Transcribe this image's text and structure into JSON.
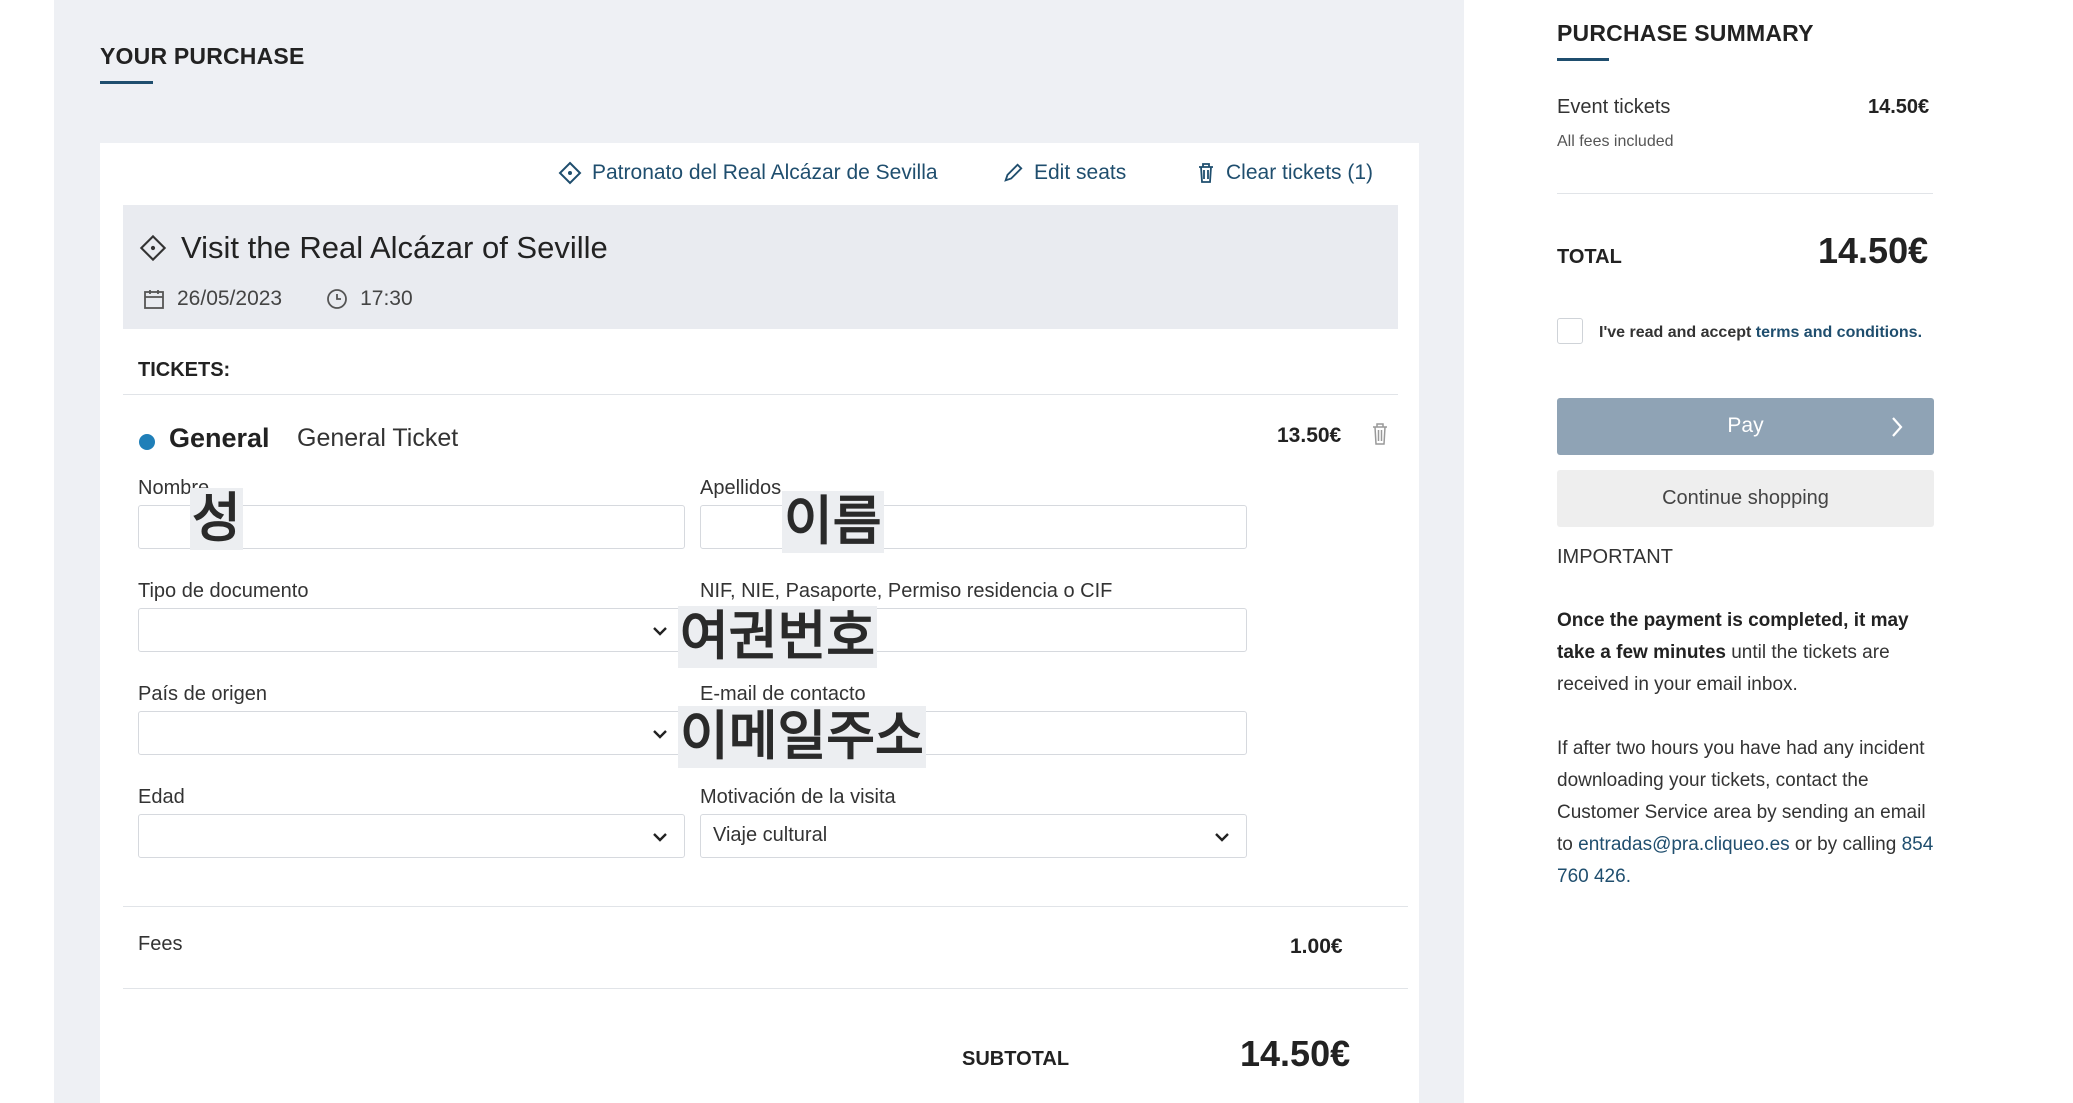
{
  "purchase": {
    "title": "YOUR PURCHASE",
    "links": {
      "venue": "Patronato del Real Alcázar de Sevilla",
      "edit_seats": "Edit seats",
      "clear_tickets": "Clear tickets (1)"
    },
    "event": {
      "title": "Visit the Real Alcázar of Seville",
      "date": "26/05/2023",
      "time": "17:30"
    },
    "tickets_heading": "TICKETS:",
    "ticket": {
      "category": "General",
      "name": "General Ticket",
      "price": "13.50€",
      "dot_color": "#1f7fb8"
    },
    "form": {
      "nombre_label": "Nombre",
      "apellidos_label": "Apellidos",
      "tipo_documento_label": "Tipo de documento",
      "documento_numero_label": "NIF, NIE, Pasaporte, Permiso residencia o CIF",
      "pais_label": "País de origen",
      "email_label": "E-mail de contacto",
      "edad_label": "Edad",
      "motivacion_label": "Motivación de la visita",
      "motivacion_value": "Viaje cultural"
    },
    "annotations": {
      "surname": "성",
      "given_name": "이름",
      "passport_number": "여권번호",
      "email": "이메일주소"
    },
    "fees_label": "Fees",
    "fees_value": "1.00€",
    "subtotal_label": "SUBTOTAL",
    "subtotal_value": "14.50€"
  },
  "summary": {
    "title": "PURCHASE SUMMARY",
    "event_tickets_label": "Event tickets",
    "event_tickets_value": "14.50€",
    "fees_note": "All fees included",
    "total_label": "TOTAL",
    "total_value": "14.50€",
    "terms_prefix": "I've read and accept ",
    "terms_link": "terms and conditions.",
    "pay_button": "Pay",
    "continue_button": "Continue shopping",
    "important_heading": "IMPORTANT",
    "important_bold": "Once the payment is completed, it may take a few minutes",
    "important_rest": " until the tickets are received in your email inbox.",
    "incident_text": "If after two hours you have had any incident downloading your tickets, contact the Customer Service area by sending an email to ",
    "contact_email": "entradas@pra.cliqueo.es",
    "calling_text": " or by calling ",
    "contact_phone": "854 760 426",
    "period": "."
  },
  "colors": {
    "accent": "#1f4e6e",
    "pay_button_bg": "#8fa3b5",
    "continue_button_bg": "#eeeeee",
    "left_background": "#eef0f4"
  }
}
